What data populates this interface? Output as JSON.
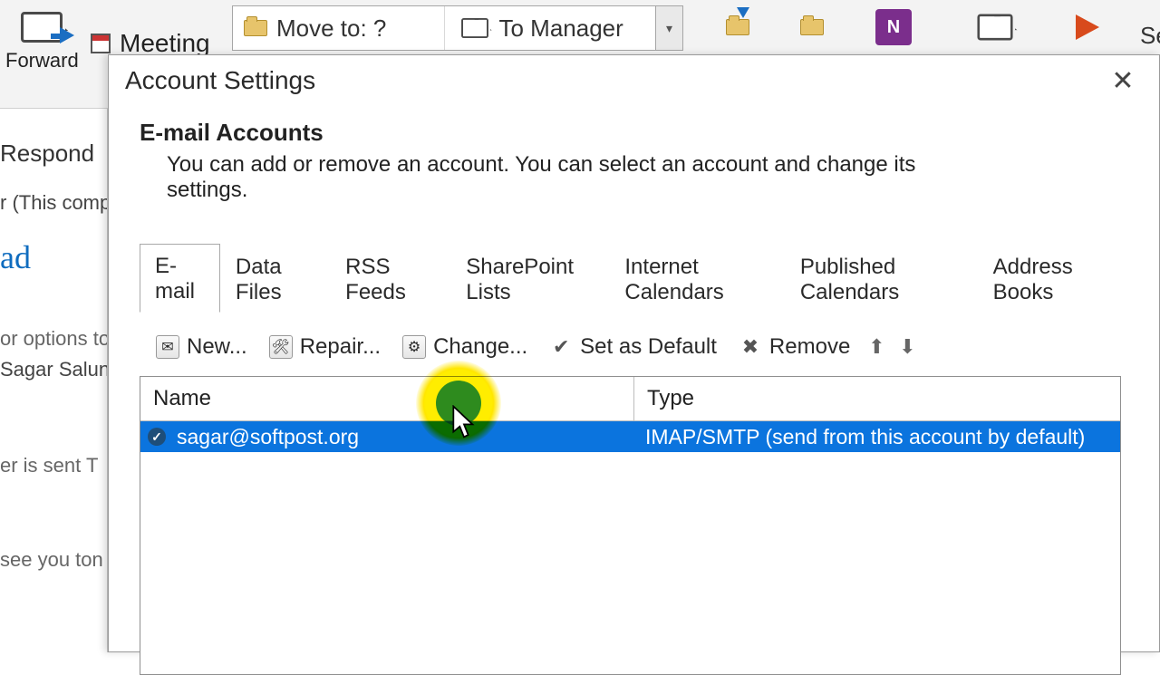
{
  "ribbon": {
    "forward": "Forward",
    "respond": "Respond",
    "meeting": "Meeting",
    "move_to": "Move to: ?",
    "to_manager": "To Manager",
    "search_stub": "Se"
  },
  "left": {
    "this_computer": "r (This comp",
    "unread_head": "ad",
    "line1": "or options to",
    "line2": "Sagar Salunl",
    "line3": "er is sent   T",
    "line4": "see you ton"
  },
  "dialog": {
    "title": "Account Settings",
    "heading": "E-mail Accounts",
    "subtitle": "You can add or remove an account. You can select an account and change its settings.",
    "tabs": [
      "E-mail",
      "Data Files",
      "RSS Feeds",
      "SharePoint Lists",
      "Internet Calendars",
      "Published Calendars",
      "Address Books"
    ],
    "toolbar": {
      "new": "New...",
      "repair": "Repair...",
      "change": "Change...",
      "set_default": "Set as Default",
      "remove": "Remove"
    },
    "columns": {
      "name": "Name",
      "type": "Type"
    },
    "rows": [
      {
        "name": "sagar@softpost.org",
        "type": "IMAP/SMTP (send from this account by default)"
      }
    ]
  }
}
